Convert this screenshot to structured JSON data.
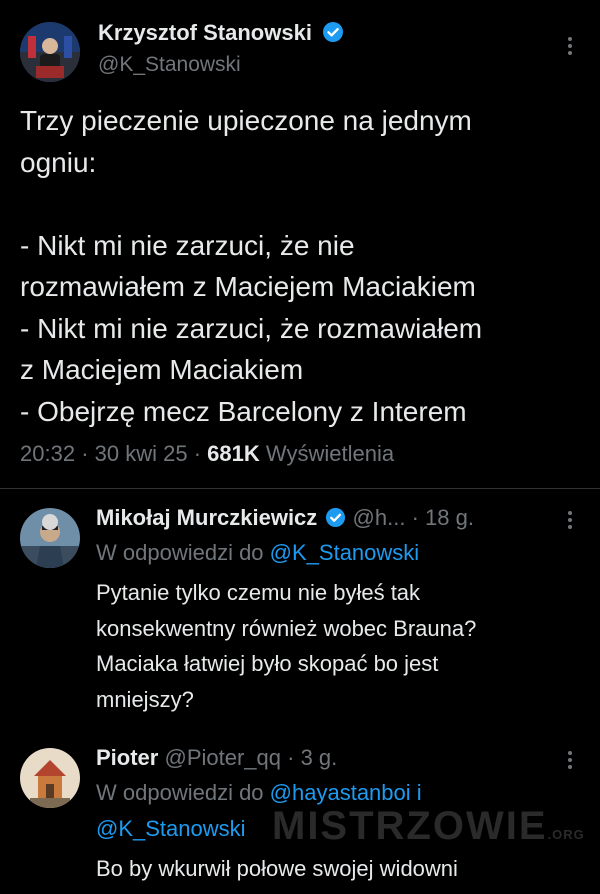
{
  "main_tweet": {
    "author_name": "Krzysztof Stanowski",
    "handle": "@K_Stanowski",
    "text_lines": [
      "Trzy pieczenie upieczone na jednym",
      "ogniu:",
      "",
      "- Nikt mi nie zarzuci, że nie",
      "rozmawiałem z Maciejem Maciakiem",
      "- Nikt mi nie zarzuci, że rozmawiałem",
      "z Maciejem Maciakiem",
      "- Obejrzę mecz Barcelony z Interem"
    ],
    "time": "20:32",
    "date": "30 kwi 25",
    "views_count": "681K",
    "views_label": "Wyświetlenia",
    "separator": "·"
  },
  "replies": [
    {
      "author_name": "Mikołaj Murczkiewicz",
      "handle": "@h...",
      "age": "18 g.",
      "reply_prefix": "W odpowiedzi do",
      "reply_to_line1": "@K_Stanowski",
      "reply_to_line2": "",
      "text_lines": [
        "Pytanie tylko czemu nie byłeś tak",
        "konsekwentny również wobec Brauna?",
        "Maciaka łatwiej było skopać bo jest",
        "mniejszy?"
      ]
    },
    {
      "author_name": "Pioter",
      "handle": "@Pioter_qq",
      "age": "3 g.",
      "reply_prefix": "W odpowiedzi do",
      "reply_to_line1": "@hayastanboi i",
      "reply_to_line2": "@K_Stanowski",
      "text_lines": [
        "Bo by wkurwił połowe swojej widowni"
      ]
    }
  ],
  "watermark": {
    "text": "MISTRZOWIE",
    "suffix": ".ORG"
  },
  "colors": {
    "background": "#000000",
    "text": "#e7e9ea",
    "muted": "#71767b",
    "link": "#1d9bf0",
    "verified": "#1d9bf0"
  }
}
